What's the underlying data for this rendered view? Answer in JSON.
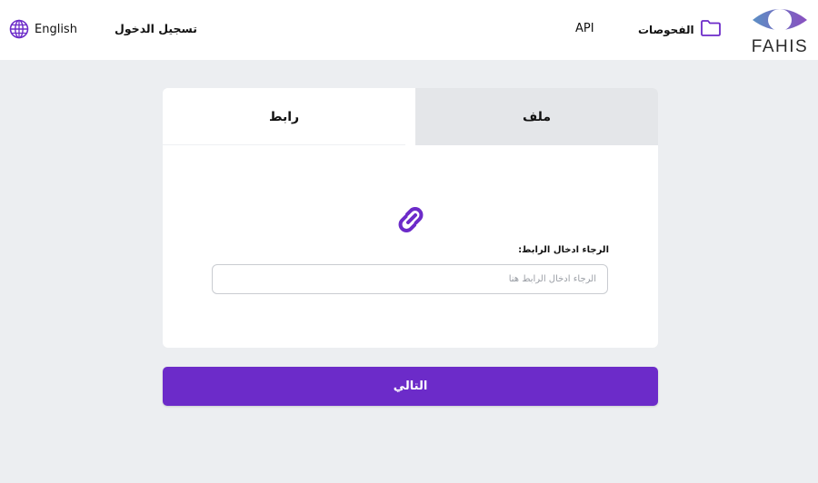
{
  "header": {
    "language_label": "English",
    "login_label": "تسجيل الدخول",
    "api_label": "API",
    "scans_label": "الفحوصات",
    "logo_text": "FAHIS"
  },
  "tabs": [
    {
      "label": "رابط",
      "active": true
    },
    {
      "label": "ملف",
      "active": false
    }
  ],
  "form": {
    "field_label": "الرجاء ادخال الرابط:",
    "input_placeholder": "الرجاء ادخال الرابط هنا",
    "input_value": ""
  },
  "next_button_label": "التالي",
  "colors": {
    "accent": "#6c2bc9",
    "page_background": "#eceef1",
    "inactive_tab": "#e4e6e9"
  },
  "icons": {
    "language": "globe-icon",
    "scans": "folder-icon",
    "main": "link-icon"
  }
}
